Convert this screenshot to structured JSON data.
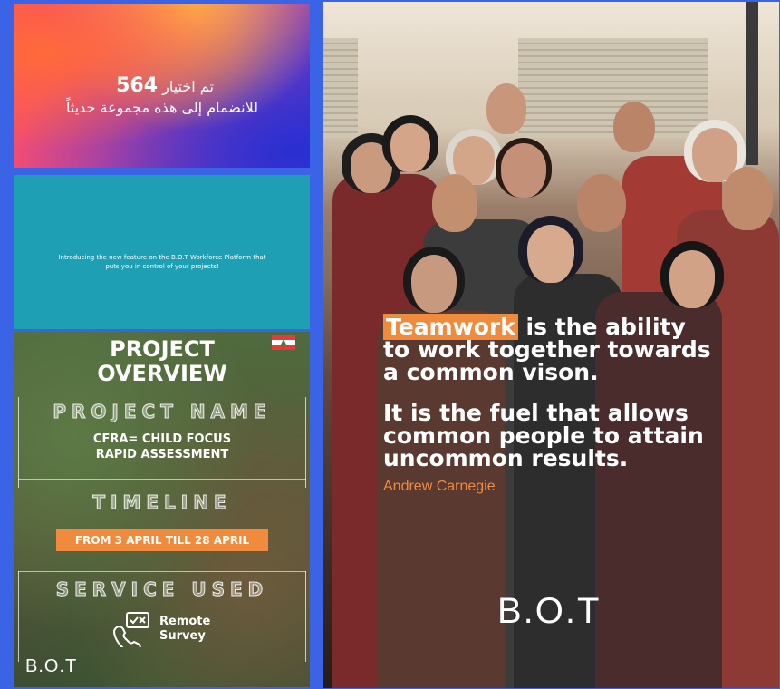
{
  "gradient_tile": {
    "arabic_line1_prefix": "تم اختيار",
    "arabic_number": "564",
    "arabic_line2": "للانضمام إلى هذه مجموعة حديثاً"
  },
  "teal_tile": {
    "intro_text": "Introducing the new feature on the B.O.T Workforce Platform that puts you in control of your projects!"
  },
  "overview_tile": {
    "title_line1": "PROJECT",
    "title_line2": "OVERVIEW",
    "project_name_heading": "PROJECT NAME",
    "project_name_line1": "CFRA= CHILD FOCUS",
    "project_name_line2": "RAPID ASSESSMENT",
    "timeline_heading": "TIMELINE",
    "timeline_value": "FROM 3 APRIL TILL 28 APRIL",
    "service_heading": "SERVICE USED",
    "service_line1": "Remote",
    "service_line2": "Survey",
    "brand": "B.O.T",
    "flag_icon": "lebanon-flag-icon"
  },
  "photo_tile": {
    "highlight_word": "Teamwork",
    "quote_line1_rest": " is the ability",
    "quote_line2": "to work together towards",
    "quote_line3": "a common vison.",
    "quote2_line1": "It is the fuel that allows",
    "quote2_line2": "common people to attain",
    "quote2_line3": "uncommon results.",
    "author": "Andrew Carnegie",
    "brand": "B.O.T"
  },
  "colors": {
    "accent_orange": "#f08a3c",
    "frame_blue": "#3a63e6",
    "teal": "#1f9fb3"
  }
}
